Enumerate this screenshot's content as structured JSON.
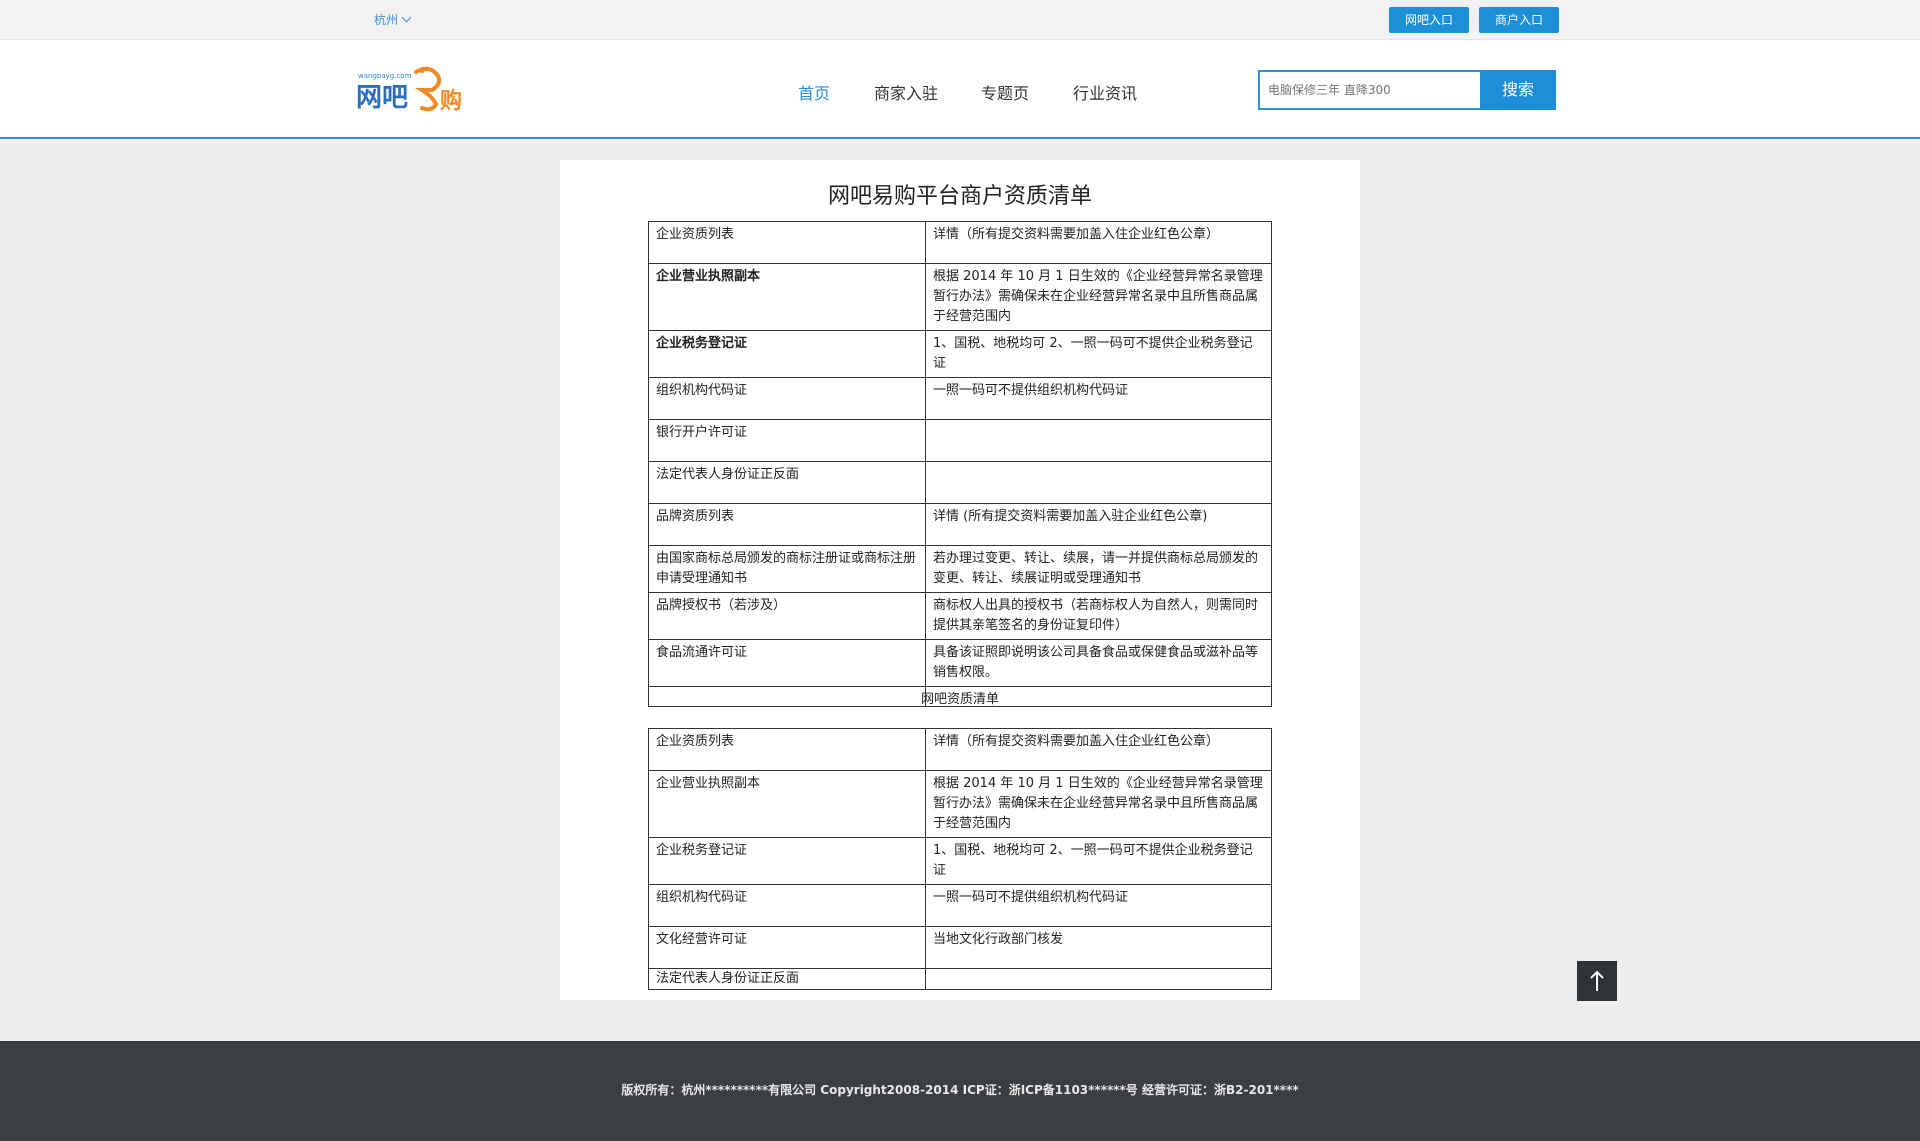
{
  "topbar": {
    "city": "杭州",
    "wangba_entry": "网吧入口",
    "merchant_entry": "商户入口"
  },
  "header": {
    "logo_text": "网吧易购",
    "logo_small": "wangbayg.com",
    "nav": [
      "首页",
      "商家入驻",
      "专题页",
      "行业资讯"
    ],
    "search_placeholder": "电脑保修三年 直降300",
    "search_button": "搜索"
  },
  "colors": {
    "accent": "#2b8fdc",
    "logo_orange": "#f08a24",
    "footer_bg": "#3b3e42"
  },
  "document": {
    "title": "网吧易购平台商户资质清单",
    "table1": [
      [
        "企业资质列表",
        "详情（所有提交资料需要加盖入住企业红色公章）"
      ],
      [
        "企业营业执照副本",
        "根据 2014 年 10 月 1 日生效的《企业经营异常名录管理暂行办法》需确保未在企业经营异常名录中且所售商品属于经营范围内"
      ],
      [
        "企业税务登记证",
        "1、国税、地税均可 2、一照一码可不提供企业税务登记证"
      ],
      [
        "组织机构代码证",
        "一照一码可不提供组织机构代码证"
      ],
      [
        "银行开户许可证",
        ""
      ],
      [
        "法定代表人身份证正反面",
        ""
      ],
      [
        "品牌资质列表",
        "详情 (所有提交资料需要加盖入驻企业红色公章)"
      ],
      [
        "由国家商标总局颁发的商标注册证或商标注册申请受理通知书",
        "若办理过变更、转让、续展，请一并提供商标总局颁发的变更、转让、续展证明或受理通知书"
      ],
      [
        "品牌授权书（若涉及）",
        "商标权人出具的授权书（若商标权人为自然人，则需同时提供其亲笔签名的身份证复印件）"
      ],
      [
        "食品流通许可证",
        "具备该证照即说明该公司具备食品或保健食品或滋补品等销售权限。"
      ],
      [
        "",
        ""
      ]
    ],
    "subtitle": "网吧资质清单",
    "table2": [
      [
        "企业资质列表",
        "详情（所有提交资料需要加盖入住企业红色公章）"
      ],
      [
        "企业营业执照副本",
        "根据 2014 年 10 月 1 日生效的《企业经营异常名录管理暂行办法》需确保未在企业经营异常名录中且所售商品属于经营范围内"
      ],
      [
        "企业税务登记证",
        "1、国税、地税均可 2、一照一码可不提供企业税务登记证"
      ],
      [
        "组织机构代码证",
        "一照一码可不提供组织机构代码证"
      ],
      [
        "文化经营许可证",
        "当地文化行政部门核发"
      ],
      [
        "法定代表人身份证正反面",
        ""
      ]
    ]
  },
  "footer": {
    "copyright": "版权所有：杭州**********有限公司 Copyright2008-2014 ICP证：浙ICP备1103******号 经营许可证：浙B2-201****"
  }
}
